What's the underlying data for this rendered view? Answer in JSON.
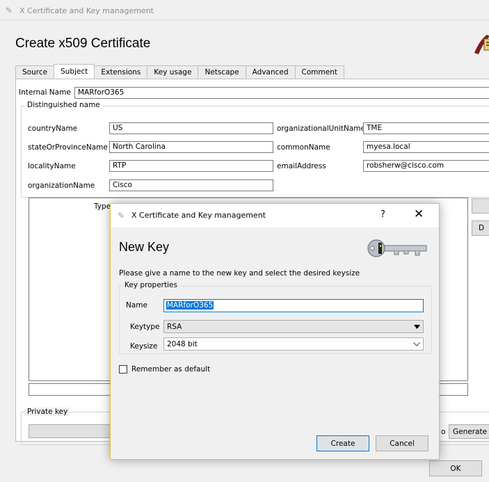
{
  "window": {
    "title": "X Certificate and Key management"
  },
  "page": {
    "title": "Create x509 Certificate"
  },
  "tabs": [
    "Source",
    "Subject",
    "Extensions",
    "Key usage",
    "Netscape",
    "Advanced",
    "Comment"
  ],
  "internal_name": {
    "label": "Internal Name",
    "value": "MARforO365"
  },
  "distinguished": {
    "label": "Distinguished name",
    "fields": {
      "country": {
        "label": "countryName",
        "value": "US"
      },
      "state": {
        "label": "stateOrProvinceName",
        "value": "North Carolina"
      },
      "locality": {
        "label": "localityName",
        "value": "RTP"
      },
      "org": {
        "label": "organizationName",
        "value": "Cisco"
      },
      "ou": {
        "label": "organizationalUnitName",
        "value": "TME"
      },
      "cn": {
        "label": "commonName",
        "value": "myesa.local"
      },
      "email": {
        "label": "emailAddress",
        "value": "robsherw@cisco.com"
      }
    },
    "table_header_partial": "Type"
  },
  "private_key": {
    "label": "Private key",
    "generate_label": "Generate a",
    "partial_text": "o"
  },
  "side_button_partial": "D",
  "ok_label": "OK",
  "dialog": {
    "title": "X Certificate and Key management",
    "help": "?",
    "close": "✕",
    "heading": "New Key",
    "description": "Please give a name to the new key and select the desired keysize",
    "group_label": "Key properties",
    "name_label": "Name",
    "name_value": "MARforO365",
    "keytype_label": "Keytype",
    "keytype_value": "RSA",
    "keysize_label": "Keysize",
    "keysize_value": "2048 bit",
    "remember_label": "Remember as default",
    "create_label": "Create",
    "cancel_label": "Cancel"
  }
}
